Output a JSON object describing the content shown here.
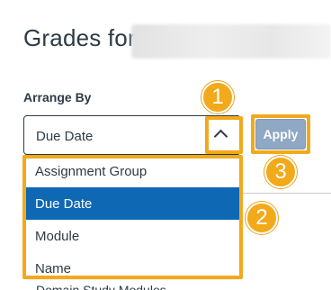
{
  "header": {
    "title": "Grades for"
  },
  "arrange": {
    "label": "Arrange By",
    "selected_value": "Due Date",
    "apply_label": "Apply",
    "options": [
      {
        "label": "Assignment Group",
        "selected": false
      },
      {
        "label": "Due Date",
        "selected": true
      },
      {
        "label": "Module",
        "selected": false
      },
      {
        "label": "Name",
        "selected": false
      }
    ]
  },
  "background_text": "Domain Study Modules",
  "callouts": {
    "one": "1",
    "two": "2",
    "three": "3"
  },
  "colors": {
    "accent": "#f2a91a",
    "selected_option": "#0e68b3",
    "apply_button": "#8fa8c3",
    "text": "#2d3b45"
  }
}
